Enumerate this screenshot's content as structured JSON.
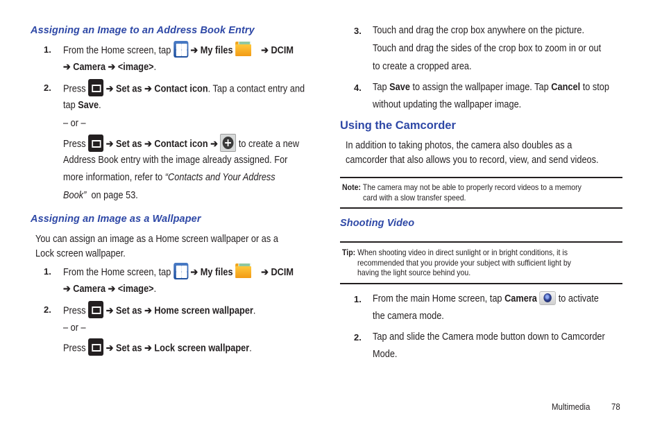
{
  "left": {
    "section1": {
      "heading": "Assigning an Image to an Address Book Entry",
      "step1": {
        "num": "1.",
        "text_a": "From the Home screen, tap",
        "arrow1": "➔",
        "myfiles": "My files",
        "arrow2": "➔",
        "dcim": "DCIM",
        "arrow3": "➔",
        "camera": "Camera",
        "arrow4": "➔",
        "image": "<image>",
        "end": "."
      },
      "step2": {
        "num": "2.",
        "press": "Press",
        "arrow1": "➔",
        "setas": "Set as",
        "arrow2": "➔",
        "contact_icon": "Contact icon",
        "text_b": ". Tap a contact entry and",
        "tap": "tap",
        "save": "Save",
        "end": ".",
        "or": "– or –",
        "press2": "Press",
        "arrow3": "➔",
        "setas2": "Set as",
        "arrow4": "➔",
        "contact_icon2": "Contact icon",
        "arrow5": "➔",
        "text_c": "to create a new",
        "line2": "Address Book entry with the image already assigned. For",
        "line3_a": "more information, refer to",
        "line3_ref": "“Contacts and Your Address",
        "line4_ref": "Book”",
        "line4_b": "on page 53."
      }
    },
    "section2": {
      "heading": "Assigning an Image as a Wallpaper",
      "intro1": "You can assign an image as a Home screen wallpaper or as a",
      "intro2": "Lock screen wallpaper.",
      "step1": {
        "num": "1.",
        "text_a": "From the Home screen, tap",
        "arrow1": "➔",
        "myfiles": "My files",
        "arrow2": "➔",
        "dcim": "DCIM",
        "arrow3": "➔",
        "camera": "Camera",
        "arrow4": "➔",
        "image": "<image>",
        "end": "."
      },
      "step2": {
        "num": "2.",
        "press": "Press",
        "arrow1": "➔",
        "setas": "Set as",
        "arrow2": "➔",
        "home_wallpaper": "Home screen wallpaper",
        "end": ".",
        "or": "– or –",
        "press2": "Press",
        "arrow3": "➔",
        "setas2": "Set as",
        "arrow4": "➔",
        "lock_wallpaper": "Lock screen wallpaper",
        "end2": "."
      }
    }
  },
  "right": {
    "step3": {
      "num": "3.",
      "line1": "Touch and drag the crop box anywhere on the picture.",
      "line2": "Touch and drag the sides of the crop box to zoom in or out",
      "line3": "to create a cropped area."
    },
    "step4": {
      "num": "4.",
      "tap": "Tap",
      "save": "Save",
      "text_a": "to assign the wallpaper image. Tap",
      "cancel": "Cancel",
      "text_b": "to stop",
      "line2": "without updating the wallpaper image."
    },
    "camcorder": {
      "heading": "Using the Camcorder",
      "intro1": "In addition to taking photos, the camera also doubles as a",
      "intro2": "camcorder that also allows you to record, view, and send videos."
    },
    "note": {
      "label": "Note:",
      "line1": "The camera may not be able to properly record videos to a memory",
      "line2": "card with a slow transfer speed."
    },
    "shooting": {
      "heading": "Shooting Video"
    },
    "tip": {
      "label": "Tip:",
      "line1": "When shooting video in direct sunlight or in bright conditions, it is",
      "line2": "recommended that you provide your subject with sufficient light by",
      "line3": "having the light source behind you."
    },
    "video_step1": {
      "num": "1.",
      "text_a": "From the main Home screen, tap",
      "camera": "Camera",
      "text_b": "to activate",
      "line2": "the camera mode."
    },
    "video_step2": {
      "num": "2.",
      "line1": "Tap and slide the Camera mode button down to Camcorder",
      "line2": "Mode."
    }
  },
  "footer": {
    "section": "Multimedia",
    "page": "78"
  },
  "icons": {
    "apps": "apps-grid-icon",
    "myfiles": "folder-icon",
    "menu": "menu-key-icon",
    "add": "add-contact-icon",
    "camera": "camera-icon"
  },
  "colors": {
    "heading": "#2e48a6",
    "text": "#231f20"
  }
}
